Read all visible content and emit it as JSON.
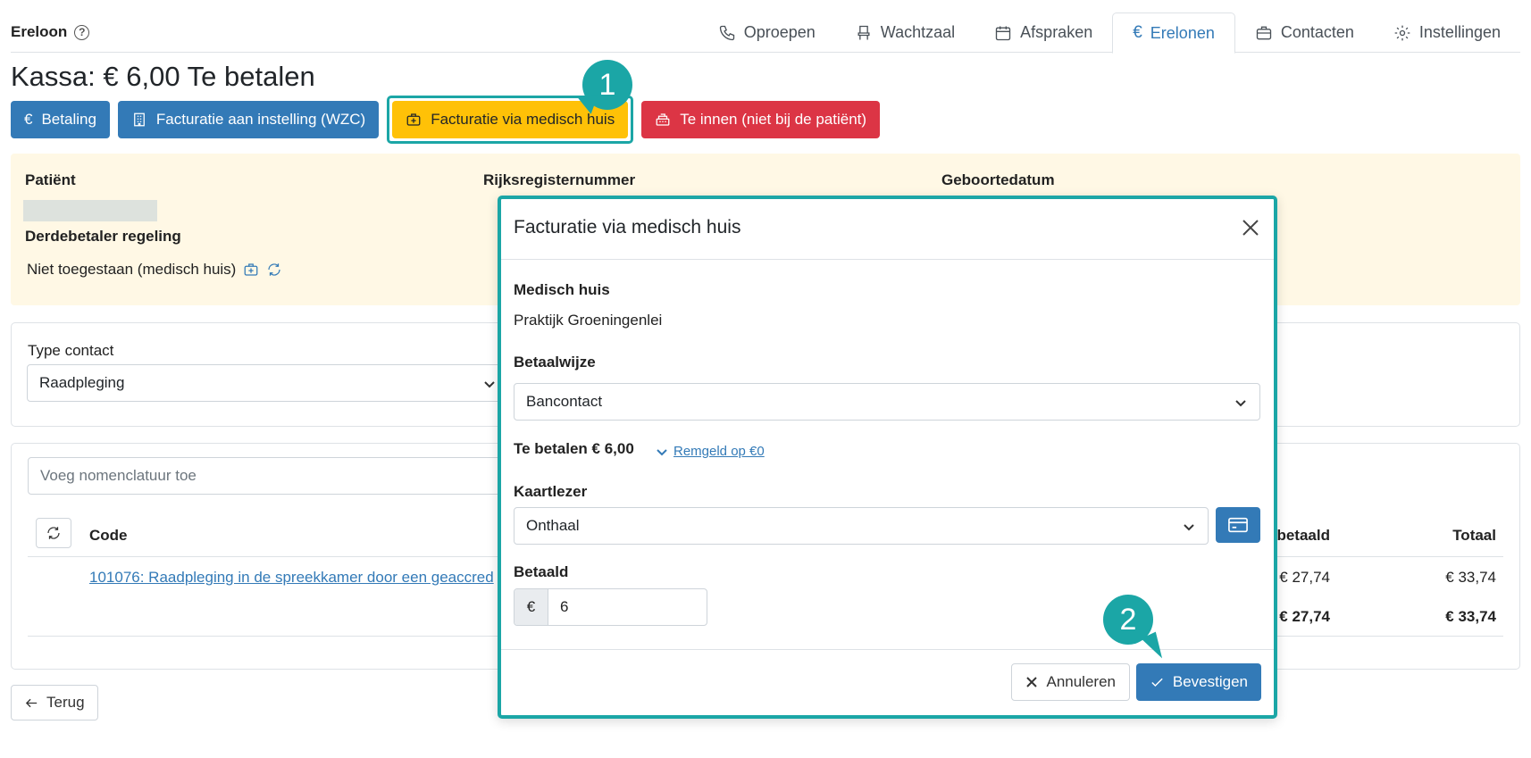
{
  "app": {
    "title": "Ereloon",
    "help_icon": "?"
  },
  "nav": {
    "tabs": [
      {
        "label": "Oproepen",
        "icon": "phone-icon"
      },
      {
        "label": "Wachtzaal",
        "icon": "chair-icon"
      },
      {
        "label": "Afspraken",
        "icon": "calendar-icon"
      },
      {
        "label": "Erelonen",
        "icon": "euro-icon",
        "active": true
      },
      {
        "label": "Contacten",
        "icon": "briefcase-icon"
      },
      {
        "label": "Instellingen",
        "icon": "gear-icon"
      }
    ],
    "euro_symbol": "€"
  },
  "page": {
    "title": "Kassa: € 6,00 Te betalen"
  },
  "actions": {
    "betaling": "Betaling",
    "facturatie_instelling": "Facturatie aan instelling (WZC)",
    "facturatie_medisch_huis": "Facturatie via medisch huis",
    "te_innen": "Te innen (niet bij de patiënt)",
    "euro_symbol": "€"
  },
  "callouts": {
    "one": "1",
    "two": "2"
  },
  "patient": {
    "patient_label": "Patiënt",
    "rrn_label": "Rijksregisternummer",
    "dob_label": "Geboortedatum",
    "third_party_label": "Derdebetaler regeling",
    "third_party_value": "Niet toegestaan (medisch huis)"
  },
  "contact": {
    "type_label": "Type contact",
    "type_value": "Raadpleging"
  },
  "nomenclature": {
    "placeholder": "Voeg nomenclatuur toe",
    "headers": {
      "code": "Code",
      "betaald": "betaald",
      "totaal": "Totaal"
    },
    "rows": [
      {
        "code": "101076: Raadpleging in de spreekkamer door een geaccred",
        "betaald": "€ 27,74",
        "totaal": "€ 33,74"
      }
    ],
    "totals": {
      "betaald": "€ 27,74",
      "totaal": "€ 33,74"
    }
  },
  "back_button": "Terug",
  "modal": {
    "title": "Facturatie via medisch huis",
    "medisch_huis_label": "Medisch huis",
    "medisch_huis_value": "Praktijk Groeningenlei",
    "betaalwijze_label": "Betaalwijze",
    "betaalwijze_value": "Bancontact",
    "te_betalen": "Te betalen € 6,00",
    "remgeld_link": "Remgeld op €0",
    "kaartlezer_label": "Kaartlezer",
    "kaartlezer_value": "Onthaal",
    "betaald_label": "Betaald",
    "betaald_prefix": "€",
    "betaald_value": "6",
    "cancel_label": "Annuleren",
    "confirm_label": "Bevestigen"
  },
  "colors": {
    "primary": "#337ab7",
    "warning": "#ffc107",
    "danger": "#dc3545",
    "highlight": "#1ba6a6",
    "patient_bg": "#fff8e5"
  }
}
